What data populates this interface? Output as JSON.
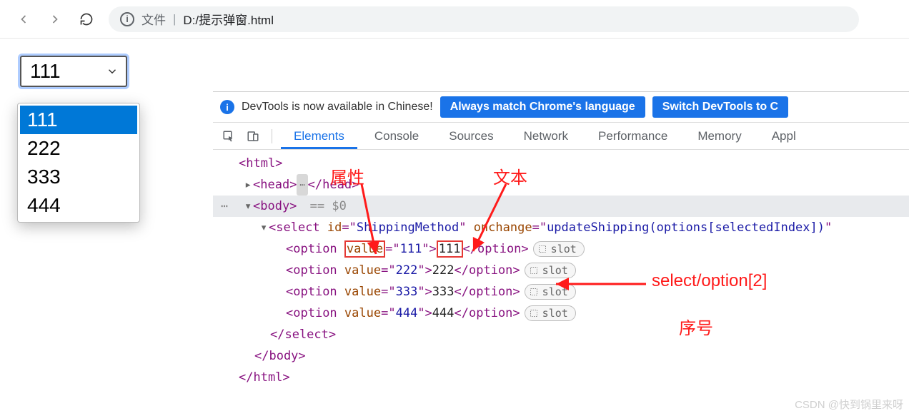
{
  "browser": {
    "file_label": "文件",
    "path": "D:/提示弹窗.html"
  },
  "page": {
    "selected": "111",
    "options": [
      "111",
      "222",
      "333",
      "444"
    ]
  },
  "devtools": {
    "notice": {
      "text": "DevTools is now available in Chinese!",
      "btn1": "Always match Chrome's language",
      "btn2": "Switch DevTools to C"
    },
    "tabs": [
      "Elements",
      "Console",
      "Sources",
      "Network",
      "Performance",
      "Memory",
      "Appl"
    ],
    "active_tab": "Elements",
    "tree": {
      "html_open": "<html>",
      "head": "<head>",
      "head_close": "</head>",
      "body_open": "<body>",
      "body_eq": "== $0",
      "select_tag": "select",
      "select_id_attr": "id",
      "select_id_val": "ShippingMethod",
      "select_onchange_attr": "onchange",
      "select_onchange_val": "updateShipping(options[selectedIndex])",
      "option_tag": "option",
      "value_attr": "value",
      "opt1_val": "111",
      "opt1_text": "111",
      "opt2_val": "222",
      "opt2_text": "222",
      "opt3_val": "333",
      "opt3_text": "333",
      "opt4_val": "444",
      "opt4_text": "444",
      "slot": "slot",
      "select_close": "</select>",
      "body_close": "</body>",
      "html_close": "</html>"
    }
  },
  "annotations": {
    "attr": "属性",
    "text": "文本",
    "xpath": "select/option[2]",
    "index": "序号"
  },
  "watermark": "CSDN @快到锅里来呀"
}
